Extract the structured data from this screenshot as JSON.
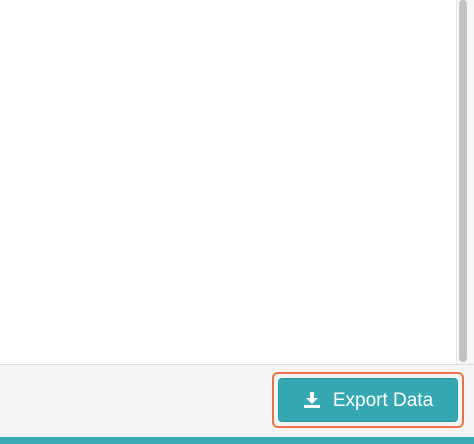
{
  "footer": {
    "export_button": {
      "label": "Export Data",
      "icon": "download-icon"
    }
  },
  "colors": {
    "button_background": "#35a8b4",
    "highlight_ring": "#e8744a",
    "accent_bar": "#3aaab5"
  }
}
